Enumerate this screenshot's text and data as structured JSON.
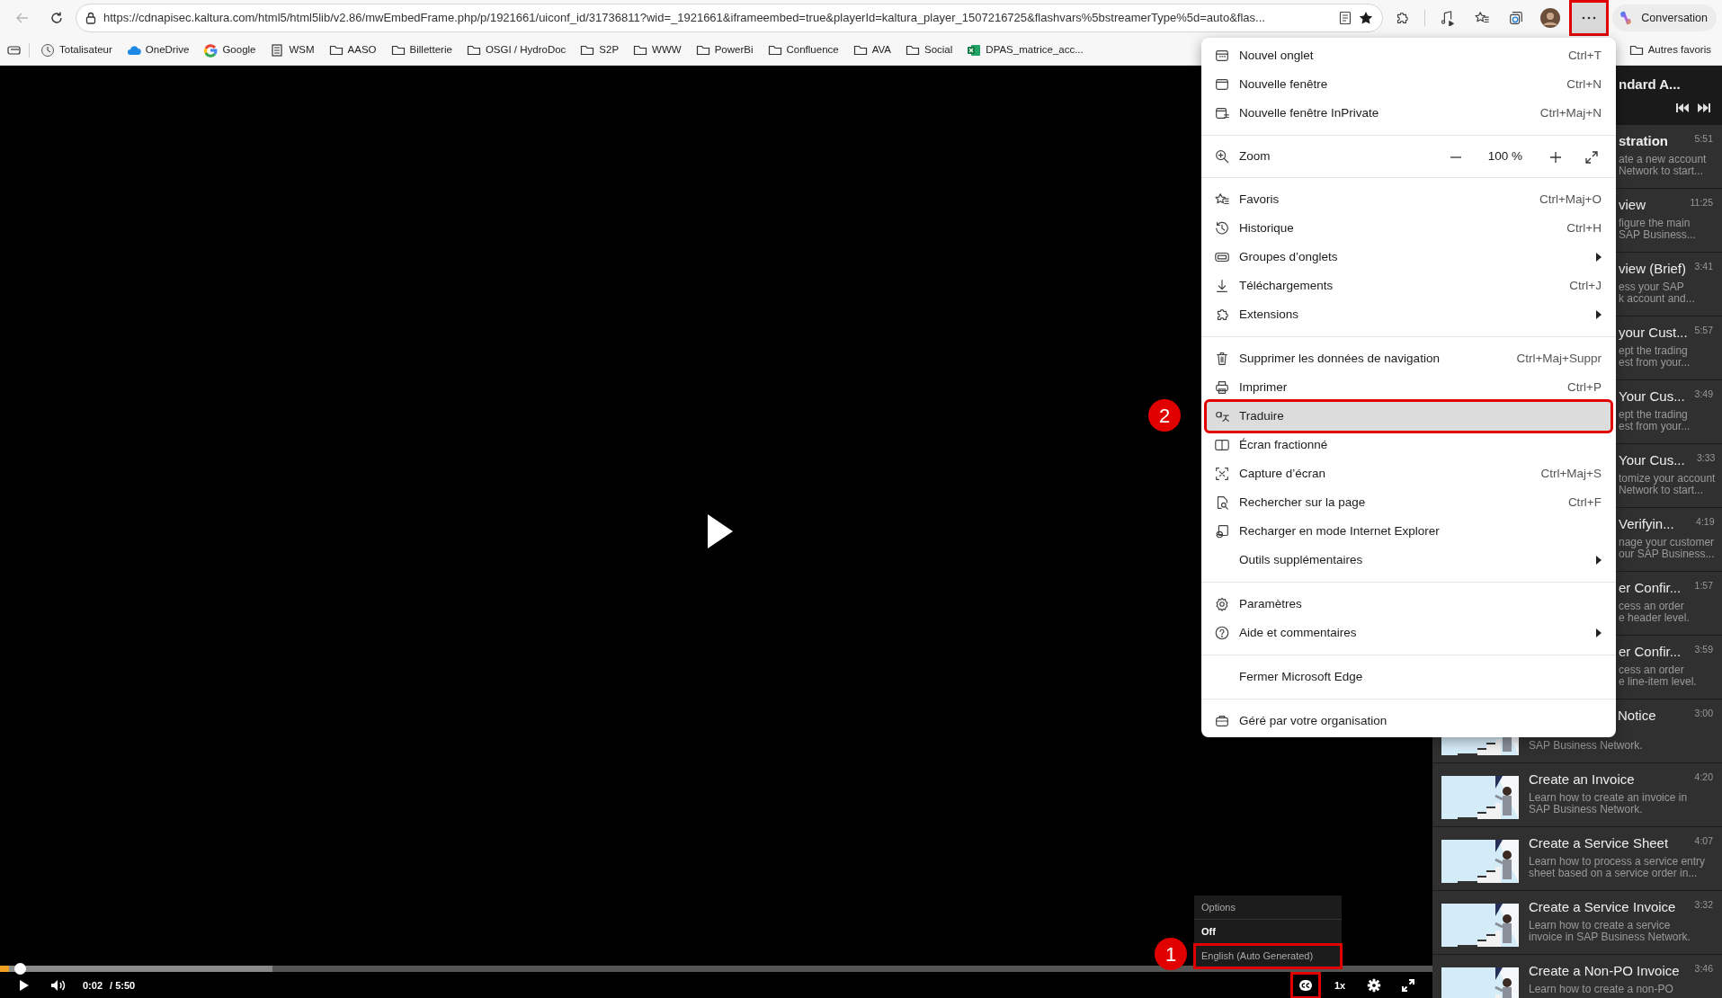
{
  "toolbar": {
    "url": "https://cdnapisec.kaltura.com/html5/html5lib/v2.86/mwEmbedFrame.php/p/1921661/uiconf_id/31736811?wid=_1921661&iframeembed=true&playerId=kaltura_player_1507216725&flashvars%5bstreamerType%5d=auto&flas...",
    "more_button": {
      "outlined": true
    },
    "copilot_button": {
      "label": "Conversation"
    }
  },
  "bookmarks": [
    {
      "label": "Totalisateur"
    },
    {
      "label": "OneDrive"
    },
    {
      "label": "Google"
    },
    {
      "label": "WSM"
    },
    {
      "label": "AASO"
    },
    {
      "label": "Billetterie"
    },
    {
      "label": "OSGI / HydroDoc"
    },
    {
      "label": "S2P"
    },
    {
      "label": "WWW"
    },
    {
      "label": "PowerBi"
    },
    {
      "label": "Confluence"
    },
    {
      "label": "AVA"
    },
    {
      "label": "Social"
    },
    {
      "label": "DPAS_matrice_acc..."
    }
  ],
  "other_bookmarks": {
    "label": "Autres favoris"
  },
  "menu": {
    "groups": [
      [
        {
          "kind": "command",
          "label": "Nouvel onglet",
          "shortcut": "Ctrl+T"
        },
        {
          "kind": "command",
          "label": "Nouvelle fenêtre",
          "shortcut": "Ctrl+N"
        },
        {
          "kind": "command",
          "label": "Nouvelle fenêtre InPrivate",
          "shortcut": "Ctrl+Maj+N"
        }
      ],
      [
        {
          "kind": "zoom",
          "label": "Zoom",
          "value": "100 %"
        }
      ],
      [
        {
          "kind": "command",
          "label": "Favoris",
          "shortcut": "Ctrl+Maj+O"
        },
        {
          "kind": "command",
          "label": "Historique",
          "shortcut": "Ctrl+H"
        },
        {
          "kind": "command",
          "label": "Groupes d’onglets",
          "submenu": true
        },
        {
          "kind": "command",
          "label": "Téléchargements",
          "shortcut": "Ctrl+J"
        },
        {
          "kind": "command",
          "label": "Extensions",
          "submenu": true
        }
      ],
      [
        {
          "kind": "command",
          "label": "Supprimer les données de navigation",
          "shortcut": "Ctrl+Maj+Suppr"
        },
        {
          "kind": "command",
          "label": "Imprimer",
          "shortcut": "Ctrl+P"
        },
        {
          "kind": "command",
          "label": "Traduire",
          "hovered": true,
          "outlined": true
        },
        {
          "kind": "command",
          "label": "Écran fractionné"
        },
        {
          "kind": "command",
          "label": "Capture d’écran",
          "shortcut": "Ctrl+Maj+S"
        },
        {
          "kind": "command",
          "label": "Rechercher sur la page",
          "shortcut": "Ctrl+F"
        },
        {
          "kind": "command",
          "label": "Recharger en mode Internet Explorer"
        },
        {
          "kind": "command",
          "label": "Outils supplémentaires",
          "submenu": true
        }
      ],
      [
        {
          "kind": "command",
          "label": "Paramètres"
        },
        {
          "kind": "command",
          "label": "Aide et commentaires",
          "submenu": true
        }
      ],
      [
        {
          "kind": "command",
          "label": "Fermer Microsoft Edge"
        }
      ],
      [
        {
          "kind": "command",
          "label": "Géré par votre organisation"
        }
      ]
    ]
  },
  "player": {
    "progress": {
      "level": 0.006
    },
    "buffer": {
      "level": 0.19
    },
    "time": "0:02",
    "duration": "/ 5:50",
    "speed": "1x",
    "cc_button": {
      "outlined": true
    },
    "caption_menu": [
      {
        "kind": "header",
        "label": "Options"
      },
      {
        "kind": "option",
        "label": "Off",
        "selected": true
      },
      {
        "kind": "option",
        "label": "English (Auto Generated)",
        "selected": false,
        "outlined": true
      }
    ]
  },
  "playlist": {
    "title": "ndard A...",
    "items": [
      {
        "kind": "covered",
        "title": "stration",
        "duration": "5:51",
        "lines": [
          "ate a new account",
          "Network to start..."
        ]
      },
      {
        "kind": "covered",
        "title": "view",
        "duration": "11:25",
        "lines": [
          "figure the main",
          "SAP Business..."
        ]
      },
      {
        "kind": "covered",
        "title": "view (Brief)",
        "duration": "3:41",
        "lines": [
          "ess your SAP",
          "k account and..."
        ]
      },
      {
        "kind": "covered",
        "title": "your Cust...",
        "duration": "5:57",
        "lines": [
          "ept the trading",
          "est from your..."
        ]
      },
      {
        "kind": "covered",
        "title": "Your Cus...",
        "duration": "3:49",
        "lines": [
          "ept the trading",
          "est from your..."
        ]
      },
      {
        "kind": "covered",
        "title": "Your Cus...",
        "duration": "3:33",
        "lines": [
          "tomize your account",
          "Network to start..."
        ]
      },
      {
        "kind": "covered",
        "title": "Verifyin...",
        "duration": "4:19",
        "lines": [
          "nage your customer",
          "our SAP Business..."
        ]
      },
      {
        "kind": "covered",
        "title": "er Confir...",
        "duration": "1:57",
        "lines": [
          "cess an order",
          "e header level."
        ]
      },
      {
        "kind": "covered",
        "title": "er Confir...",
        "duration": "3:59",
        "lines": [
          "cess an order",
          "e line-item level."
        ]
      },
      {
        "kind": "partial",
        "title": "Notice",
        "duration": "3:00",
        "lines": [
          "SAP Business Network."
        ]
      },
      {
        "kind": "full",
        "title": "Create an Invoice",
        "duration": "4:20",
        "lines": [
          "Learn how to create an invoice in",
          "SAP Business Network."
        ]
      },
      {
        "kind": "full",
        "title": "Create a Service Sheet",
        "duration": "4:07",
        "lines": [
          "Learn how to process a service entry",
          "sheet based on a service order in..."
        ]
      },
      {
        "kind": "full",
        "title": "Create a Service Invoice",
        "duration": "3:32",
        "lines": [
          "Learn how to create a service",
          "invoice in SAP Business Network."
        ]
      },
      {
        "kind": "full",
        "title": "Create a Non-PO Invoice",
        "duration": "3:46",
        "lines": [
          "Learn how to create a non-PO"
        ]
      }
    ]
  },
  "annotations": [
    {
      "label": "1"
    },
    {
      "label": "2"
    }
  ]
}
